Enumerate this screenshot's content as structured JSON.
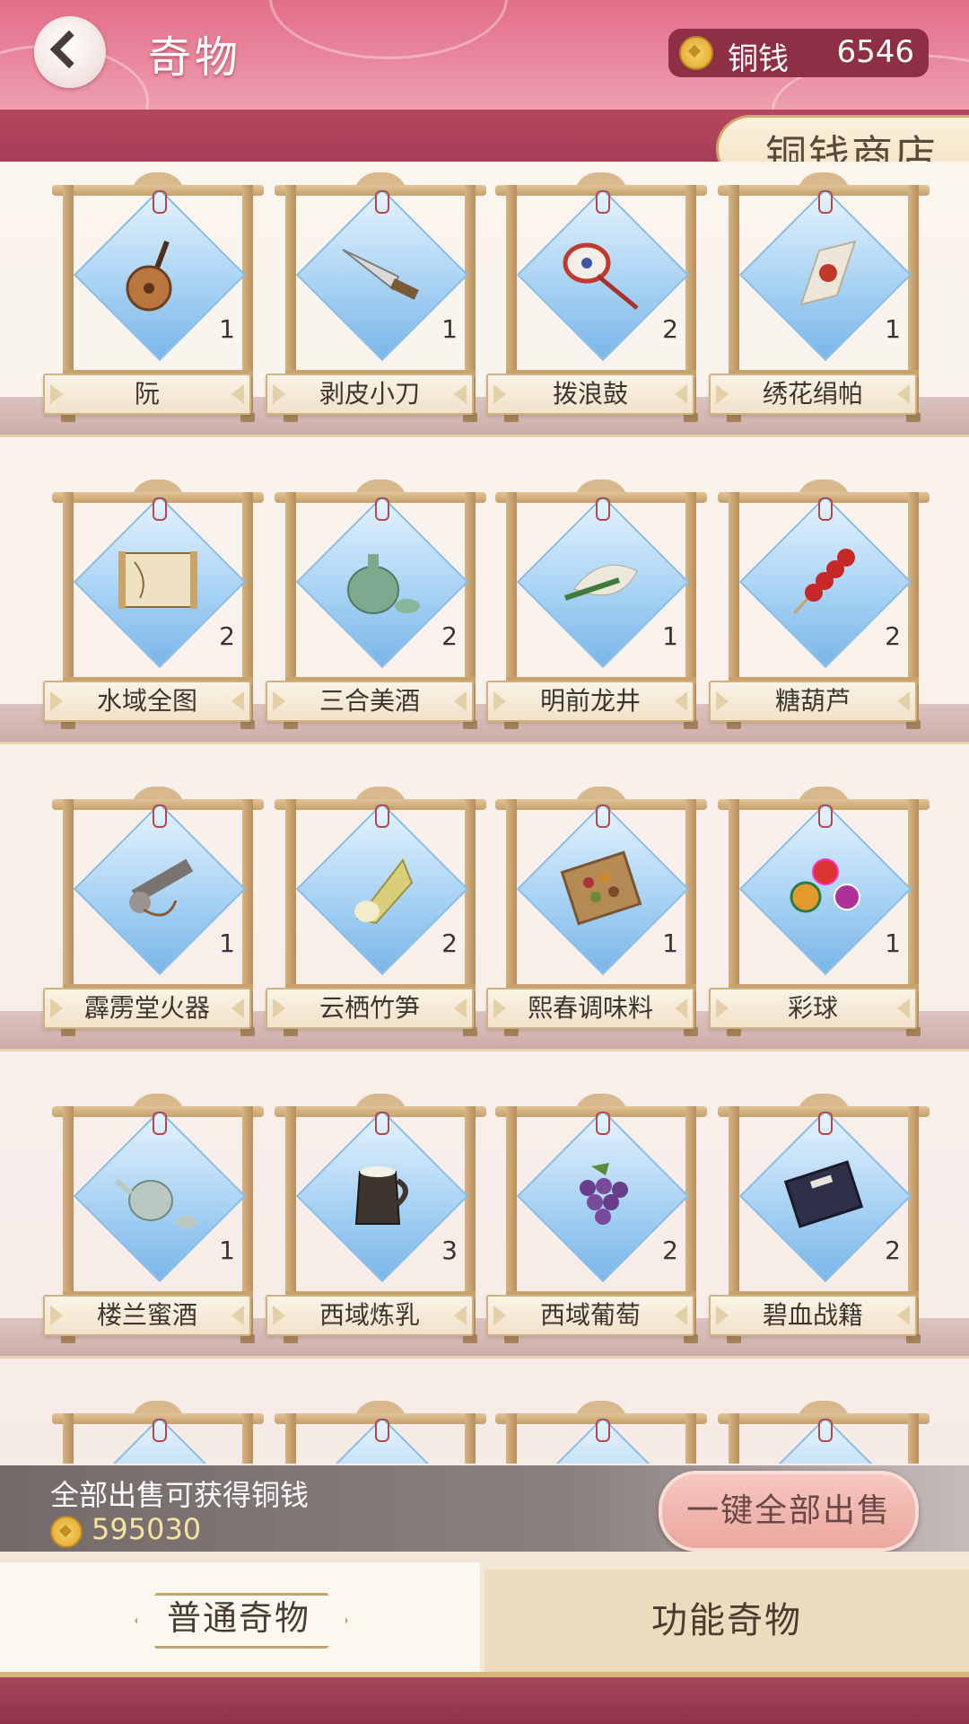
{
  "header": {
    "title": "奇物",
    "currency_label": "铜钱",
    "currency_value": "6546",
    "shop_label": "铜钱商店"
  },
  "items": [
    {
      "name": "阮",
      "count": "1",
      "icon": "ruan-lute-icon"
    },
    {
      "name": "剥皮小刀",
      "count": "1",
      "icon": "knife-icon"
    },
    {
      "name": "拨浪鼓",
      "count": "2",
      "icon": "rattle-drum-icon"
    },
    {
      "name": "绣花绢帕",
      "count": "1",
      "icon": "handkerchief-icon"
    },
    {
      "name": "水域全图",
      "count": "2",
      "icon": "map-scroll-icon"
    },
    {
      "name": "三合美酒",
      "count": "2",
      "icon": "wine-jug-icon"
    },
    {
      "name": "明前龙井",
      "count": "1",
      "icon": "tea-leaves-icon"
    },
    {
      "name": "糖葫芦",
      "count": "2",
      "icon": "candied-haws-icon"
    },
    {
      "name": "霹雳堂火器",
      "count": "1",
      "icon": "firearm-icon"
    },
    {
      "name": "云栖竹笋",
      "count": "2",
      "icon": "bamboo-shoot-icon"
    },
    {
      "name": "熙春调味料",
      "count": "1",
      "icon": "spice-box-icon"
    },
    {
      "name": "彩球",
      "count": "1",
      "icon": "colored-balls-icon"
    },
    {
      "name": "楼兰蜜酒",
      "count": "1",
      "icon": "teapot-icon"
    },
    {
      "name": "西域炼乳",
      "count": "3",
      "icon": "milk-pitcher-icon"
    },
    {
      "name": "西域葡萄",
      "count": "2",
      "icon": "grapes-icon"
    },
    {
      "name": "碧血战籍",
      "count": "2",
      "icon": "book-icon"
    }
  ],
  "sell": {
    "label": "全部出售可获得铜钱",
    "amount": "595030",
    "button_label": "一键全部出售"
  },
  "tabs": {
    "normal": "普通奇物",
    "function": "功能奇物"
  },
  "colors": {
    "header_pink": "#e26f88",
    "band_crimson": "#a63d55",
    "item_blue": "#a9d3f4",
    "frame_gold": "#c9a26c"
  }
}
